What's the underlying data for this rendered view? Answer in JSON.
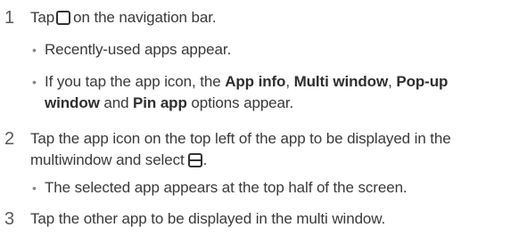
{
  "steps": [
    {
      "num": "1",
      "text_before": "Tap",
      "icon": "recent-apps-icon",
      "text_after": "on the navigation bar.",
      "bullets": [
        {
          "text": "Recently-used apps appear."
        },
        {
          "line1_pre": "If you tap the app icon, the ",
          "b1": "App info",
          "sep1": ", ",
          "b2": "Multi window",
          "sep2": ", ",
          "b3": "Pop-up",
          "line2_b": "window",
          "line2_mid": " and ",
          "b4": "Pin app",
          "line2_post": " options appear."
        }
      ]
    },
    {
      "num": "2",
      "line1": "Tap the app icon on the top left of the app to be displayed in the",
      "line2_pre": "multiwindow and select",
      "icon": "split-window-icon",
      "line2_post": ".",
      "bullets": [
        {
          "text": "The selected app appears at the top half of the screen."
        }
      ]
    },
    {
      "num": "3",
      "text": "Tap the other app to be displayed in the multi window."
    }
  ]
}
